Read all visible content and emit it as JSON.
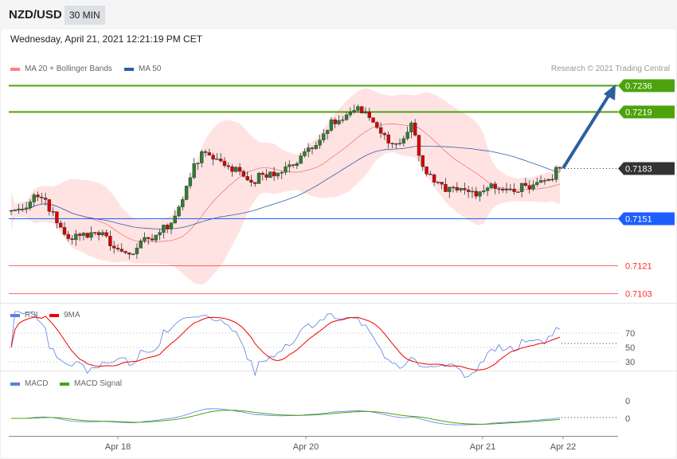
{
  "header": {
    "symbol": "NZD/USD",
    "timeframe": "30 MIN",
    "datetime": "Wednesday, April 21, 2021 12:21:19 PM CET"
  },
  "legend": {
    "ma20": "MA 20 + Bollinger Bands",
    "ma50": "MA 50",
    "rsi": "RSI",
    "rsi_ma": "9MA",
    "macd": "MACD",
    "macd_signal": "MACD Signal"
  },
  "copyright": "Research © 2021 Trading Central",
  "colors": {
    "bull": "#2e7d32",
    "bear": "#d50000",
    "band": "#ffdede",
    "ma20": "#f27a7a",
    "ma50": "#3a5fa8",
    "target": "#4ca30d",
    "pivot": "#1e5eff",
    "support": "#ff2b2b",
    "last": "#333333",
    "arrow": "#2c5f9e"
  },
  "chart_data": {
    "type": "candlestick",
    "closes": [
      0.7156,
      0.7157,
      0.7166,
      0.7163,
      0.7148,
      0.7138,
      0.714,
      0.7142,
      0.7142,
      0.7132,
      0.7129,
      0.7132,
      0.7138,
      0.7142,
      0.7148,
      0.7163,
      0.7186,
      0.7193,
      0.7189,
      0.7184,
      0.7181,
      0.7174,
      0.7179,
      0.7178,
      0.7184,
      0.7186,
      0.7196,
      0.7201,
      0.7214,
      0.7214,
      0.722,
      0.7219,
      0.7209,
      0.7199,
      0.7199,
      0.7212,
      0.7184,
      0.7174,
      0.7168,
      0.7169,
      0.7168,
      0.7168,
      0.7173,
      0.7169,
      0.7168,
      0.7172,
      0.7174,
      0.7176,
      0.7183
    ],
    "levels": [
      {
        "label": "0.7236",
        "value": 0.7236,
        "kind": "target"
      },
      {
        "label": "0.7219",
        "value": 0.7219,
        "kind": "target"
      },
      {
        "label": "0.7183",
        "value": 0.7183,
        "kind": "last"
      },
      {
        "label": "0.7151",
        "value": 0.7151,
        "kind": "pivot"
      },
      {
        "label": "0.7121",
        "value": 0.7121,
        "kind": "support"
      },
      {
        "label": "0.7103",
        "value": 0.7103,
        "kind": "support"
      }
    ],
    "rsi_ticks": [
      "70",
      "50",
      "30"
    ],
    "macd_ticks": [
      "0",
      "0"
    ],
    "x_ticks": [
      "Apr 18",
      "Apr 20",
      "Apr 21",
      "Apr 22"
    ]
  }
}
